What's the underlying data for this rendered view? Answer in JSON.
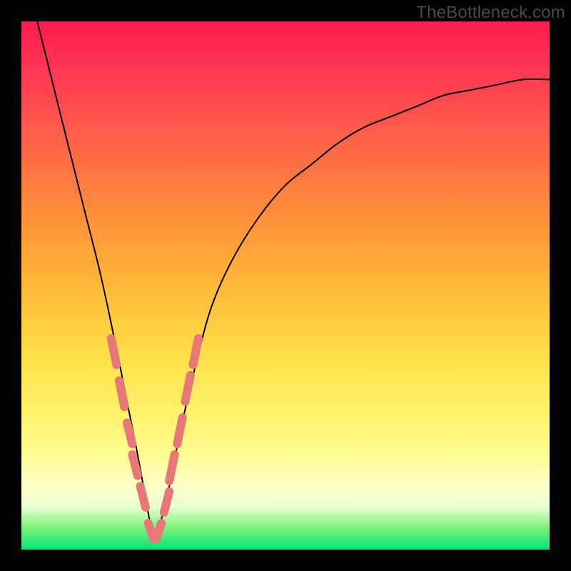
{
  "watermark": "TheBottleneck.com",
  "colors": {
    "frame": "#000000",
    "line": "#000000",
    "annotation": "#e87878",
    "gradient_top": "#ff1a4d",
    "gradient_bottom": "#00e676"
  },
  "chart_data": {
    "type": "line",
    "title": "",
    "xlabel": "",
    "ylabel": "",
    "xlim": [
      0,
      100
    ],
    "ylim": [
      0,
      100
    ],
    "grid": false,
    "legend": false,
    "note": "V-shaped bottleneck curve; values estimated from pixel positions (0=bottom, 100=top). Minimum around x≈25.",
    "series": [
      {
        "name": "curve",
        "x": [
          3,
          6,
          9,
          12,
          15,
          18,
          20,
          22,
          24,
          25,
          26,
          28,
          30,
          33,
          36,
          40,
          45,
          50,
          55,
          60,
          65,
          70,
          75,
          80,
          85,
          90,
          95,
          100
        ],
        "y": [
          100,
          88,
          76,
          64,
          52,
          38,
          28,
          18,
          7,
          2,
          4,
          12,
          22,
          35,
          46,
          55,
          63,
          69,
          73,
          77,
          80,
          82,
          84,
          86,
          87,
          88,
          89,
          89
        ]
      }
    ],
    "annotations": [
      {
        "name": "highlight-pills",
        "description": "Short salmon-pink segments over the curve near the trough region",
        "segments": [
          {
            "x1": 17,
            "y1": 40,
            "x2": 18,
            "y2": 35
          },
          {
            "x1": 18.5,
            "y1": 32,
            "x2": 19.5,
            "y2": 27
          },
          {
            "x1": 20,
            "y1": 24,
            "x2": 21,
            "y2": 20
          },
          {
            "x1": 21,
            "y1": 18,
            "x2": 22,
            "y2": 14
          },
          {
            "x1": 22.5,
            "y1": 12,
            "x2": 23.5,
            "y2": 8
          },
          {
            "x1": 24,
            "y1": 5,
            "x2": 25,
            "y2": 2
          },
          {
            "x1": 25.5,
            "y1": 2,
            "x2": 26.5,
            "y2": 5
          },
          {
            "x1": 27,
            "y1": 7,
            "x2": 28,
            "y2": 11
          },
          {
            "x1": 28,
            "y1": 13,
            "x2": 29,
            "y2": 18
          },
          {
            "x1": 29.5,
            "y1": 20,
            "x2": 30.5,
            "y2": 25
          },
          {
            "x1": 31,
            "y1": 28,
            "x2": 32,
            "y2": 33
          },
          {
            "x1": 32.5,
            "y1": 35,
            "x2": 33.5,
            "y2": 40
          }
        ]
      }
    ]
  }
}
